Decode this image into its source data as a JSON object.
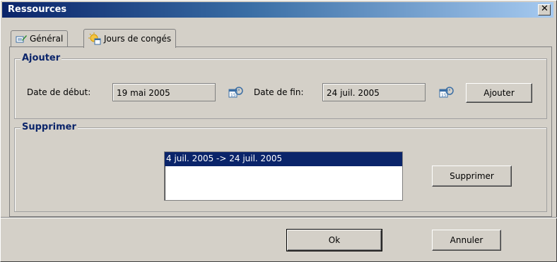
{
  "window": {
    "title": "Ressources"
  },
  "tabs": [
    {
      "label": "Général",
      "icon": "edit-icon"
    },
    {
      "label": "Jours de congés",
      "icon": "calendar-sun-icon"
    }
  ],
  "add_group": {
    "legend": "Ajouter",
    "start_label": "Date de début:",
    "start_value": "19 mai 2005",
    "end_label": "Date de fin:",
    "end_value": "24 juil. 2005",
    "add_button": "Ajouter"
  },
  "remove_group": {
    "legend": "Supprimer",
    "list": [
      "4 juil. 2005 -> 24 juil. 2005"
    ],
    "remove_button": "Supprimer"
  },
  "footer": {
    "ok": "Ok",
    "cancel": "Annuler"
  },
  "colors": {
    "titlebar_start": "#0a246a",
    "selection": "#0a246a",
    "legend_text": "#0a246a"
  }
}
